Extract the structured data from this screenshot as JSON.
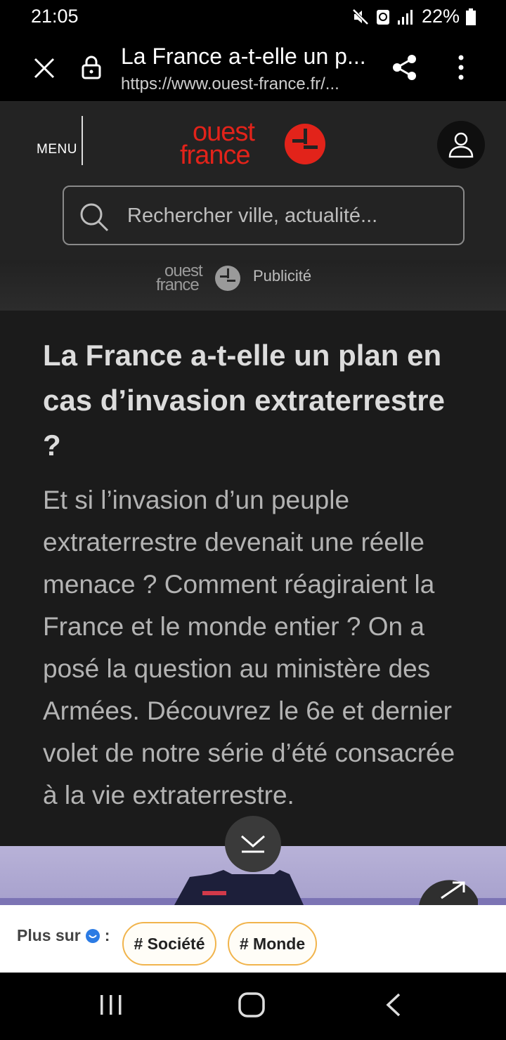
{
  "status": {
    "time": "21:05",
    "battery": "22%"
  },
  "browser": {
    "title": "La France a-t-elle un p...",
    "url": "https://www.ouest-france.fr/..."
  },
  "header": {
    "menu_label": "MENU",
    "logo_line1": "ouest",
    "logo_line2": "france",
    "search_placeholder": "Rechercher ville, actualité..."
  },
  "ad": {
    "label": "Publicité",
    "logo_line1": "ouest",
    "logo_line2": "france"
  },
  "article": {
    "title": "La France a-t-elle un plan en cas d’invasion extraterrestre ?",
    "lead": "Et si l’invasion d’un peuple extraterrestre devenait une réelle menace ? Comment réagiraient la France et le monde entier ? On a posé la question au ministère des Armées. Découvrez le 6e et dernier volet de notre série d’été consacrée à la vie extraterrestre."
  },
  "tags": {
    "label": "Plus sur",
    "colon": ":",
    "items": [
      "# Société",
      "# Monde"
    ]
  },
  "colors": {
    "brand": "#e2231a",
    "tag_border": "#f1b44c",
    "article_bg": "#1b1b1b"
  }
}
